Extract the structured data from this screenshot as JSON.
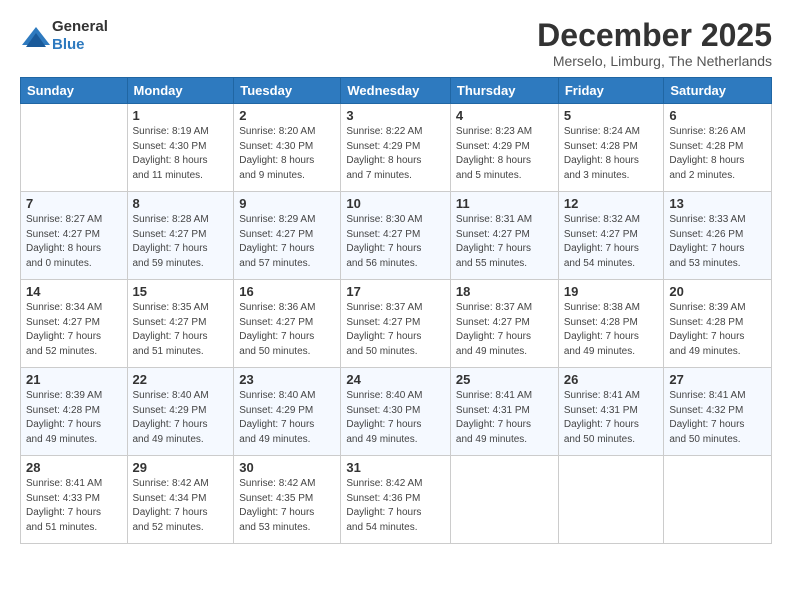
{
  "logo": {
    "line1": "General",
    "line2": "Blue"
  },
  "title": "December 2025",
  "location": "Merselo, Limburg, The Netherlands",
  "weekdays": [
    "Sunday",
    "Monday",
    "Tuesday",
    "Wednesday",
    "Thursday",
    "Friday",
    "Saturday"
  ],
  "weeks": [
    [
      {
        "day": "",
        "info": ""
      },
      {
        "day": "1",
        "info": "Sunrise: 8:19 AM\nSunset: 4:30 PM\nDaylight: 8 hours\nand 11 minutes."
      },
      {
        "day": "2",
        "info": "Sunrise: 8:20 AM\nSunset: 4:30 PM\nDaylight: 8 hours\nand 9 minutes."
      },
      {
        "day": "3",
        "info": "Sunrise: 8:22 AM\nSunset: 4:29 PM\nDaylight: 8 hours\nand 7 minutes."
      },
      {
        "day": "4",
        "info": "Sunrise: 8:23 AM\nSunset: 4:29 PM\nDaylight: 8 hours\nand 5 minutes."
      },
      {
        "day": "5",
        "info": "Sunrise: 8:24 AM\nSunset: 4:28 PM\nDaylight: 8 hours\nand 3 minutes."
      },
      {
        "day": "6",
        "info": "Sunrise: 8:26 AM\nSunset: 4:28 PM\nDaylight: 8 hours\nand 2 minutes."
      }
    ],
    [
      {
        "day": "7",
        "info": "Sunrise: 8:27 AM\nSunset: 4:27 PM\nDaylight: 8 hours\nand 0 minutes."
      },
      {
        "day": "8",
        "info": "Sunrise: 8:28 AM\nSunset: 4:27 PM\nDaylight: 7 hours\nand 59 minutes."
      },
      {
        "day": "9",
        "info": "Sunrise: 8:29 AM\nSunset: 4:27 PM\nDaylight: 7 hours\nand 57 minutes."
      },
      {
        "day": "10",
        "info": "Sunrise: 8:30 AM\nSunset: 4:27 PM\nDaylight: 7 hours\nand 56 minutes."
      },
      {
        "day": "11",
        "info": "Sunrise: 8:31 AM\nSunset: 4:27 PM\nDaylight: 7 hours\nand 55 minutes."
      },
      {
        "day": "12",
        "info": "Sunrise: 8:32 AM\nSunset: 4:27 PM\nDaylight: 7 hours\nand 54 minutes."
      },
      {
        "day": "13",
        "info": "Sunrise: 8:33 AM\nSunset: 4:26 PM\nDaylight: 7 hours\nand 53 minutes."
      }
    ],
    [
      {
        "day": "14",
        "info": "Sunrise: 8:34 AM\nSunset: 4:27 PM\nDaylight: 7 hours\nand 52 minutes."
      },
      {
        "day": "15",
        "info": "Sunrise: 8:35 AM\nSunset: 4:27 PM\nDaylight: 7 hours\nand 51 minutes."
      },
      {
        "day": "16",
        "info": "Sunrise: 8:36 AM\nSunset: 4:27 PM\nDaylight: 7 hours\nand 50 minutes."
      },
      {
        "day": "17",
        "info": "Sunrise: 8:37 AM\nSunset: 4:27 PM\nDaylight: 7 hours\nand 50 minutes."
      },
      {
        "day": "18",
        "info": "Sunrise: 8:37 AM\nSunset: 4:27 PM\nDaylight: 7 hours\nand 49 minutes."
      },
      {
        "day": "19",
        "info": "Sunrise: 8:38 AM\nSunset: 4:28 PM\nDaylight: 7 hours\nand 49 minutes."
      },
      {
        "day": "20",
        "info": "Sunrise: 8:39 AM\nSunset: 4:28 PM\nDaylight: 7 hours\nand 49 minutes."
      }
    ],
    [
      {
        "day": "21",
        "info": "Sunrise: 8:39 AM\nSunset: 4:28 PM\nDaylight: 7 hours\nand 49 minutes."
      },
      {
        "day": "22",
        "info": "Sunrise: 8:40 AM\nSunset: 4:29 PM\nDaylight: 7 hours\nand 49 minutes."
      },
      {
        "day": "23",
        "info": "Sunrise: 8:40 AM\nSunset: 4:29 PM\nDaylight: 7 hours\nand 49 minutes."
      },
      {
        "day": "24",
        "info": "Sunrise: 8:40 AM\nSunset: 4:30 PM\nDaylight: 7 hours\nand 49 minutes."
      },
      {
        "day": "25",
        "info": "Sunrise: 8:41 AM\nSunset: 4:31 PM\nDaylight: 7 hours\nand 49 minutes."
      },
      {
        "day": "26",
        "info": "Sunrise: 8:41 AM\nSunset: 4:31 PM\nDaylight: 7 hours\nand 50 minutes."
      },
      {
        "day": "27",
        "info": "Sunrise: 8:41 AM\nSunset: 4:32 PM\nDaylight: 7 hours\nand 50 minutes."
      }
    ],
    [
      {
        "day": "28",
        "info": "Sunrise: 8:41 AM\nSunset: 4:33 PM\nDaylight: 7 hours\nand 51 minutes."
      },
      {
        "day": "29",
        "info": "Sunrise: 8:42 AM\nSunset: 4:34 PM\nDaylight: 7 hours\nand 52 minutes."
      },
      {
        "day": "30",
        "info": "Sunrise: 8:42 AM\nSunset: 4:35 PM\nDaylight: 7 hours\nand 53 minutes."
      },
      {
        "day": "31",
        "info": "Sunrise: 8:42 AM\nSunset: 4:36 PM\nDaylight: 7 hours\nand 54 minutes."
      },
      {
        "day": "",
        "info": ""
      },
      {
        "day": "",
        "info": ""
      },
      {
        "day": "",
        "info": ""
      }
    ]
  ]
}
